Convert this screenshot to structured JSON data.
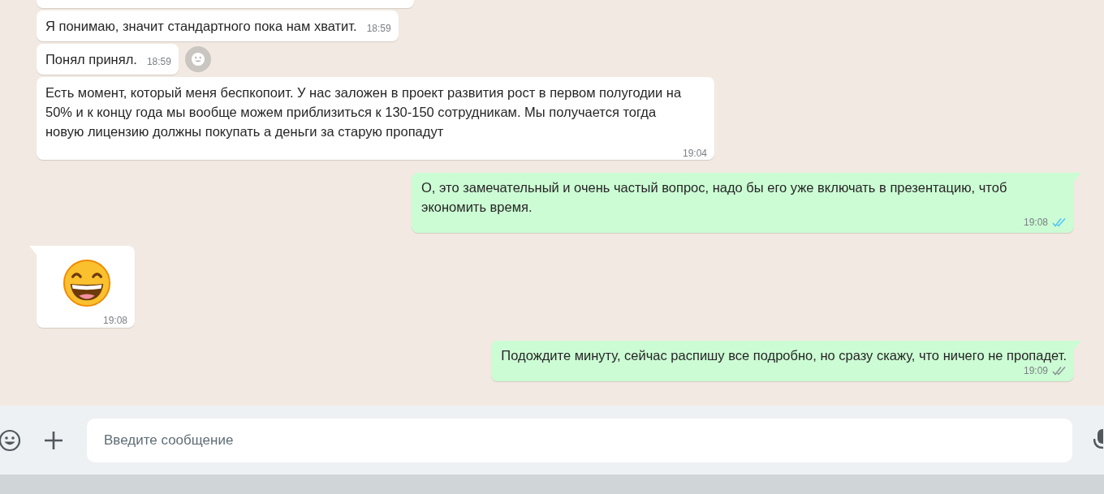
{
  "messages": [
    {
      "kind": "in"
    },
    {
      "kind": "in",
      "text": "Я понимаю, значит стандартного пока нам хватит.",
      "time": "18:59"
    },
    {
      "kind": "in",
      "text": "Понял принял.",
      "time": "18:59",
      "reaction_button": true
    },
    {
      "kind": "in",
      "text": "Есть момент, который меня беспкопоит. У нас заложен в проект развития рост в первом полугодии на 50% и к концу года мы вообще можем приблизиться к 130-150 сотрудникам. Мы получается тогда новую лицензию должны покупать а деньги за старую пропадут",
      "time": "19:04"
    },
    {
      "kind": "out",
      "tail": true,
      "text": "О, это замечательный и очень частый вопрос, надо бы его уже включать в презентацию, чтоб экономить время.",
      "time": "19:08",
      "read": true
    },
    {
      "kind": "emoji",
      "tail": true,
      "time": "19:08"
    },
    {
      "kind": "out",
      "tail": true,
      "text": "Подождите минуту, сейчас распишу все подробно, но сразу скажу, что ничего не пропадет.",
      "time": "19:09",
      "read": false
    }
  ],
  "composer": {
    "placeholder": "Введите сообщение"
  }
}
